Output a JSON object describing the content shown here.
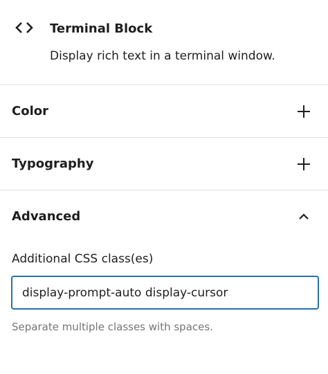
{
  "block": {
    "icon": "code-brackets-icon",
    "title": "Terminal Block",
    "description": "Display rich text in a terminal window."
  },
  "panels": [
    {
      "title": "Color",
      "expanded": false,
      "icon": "plus-icon"
    },
    {
      "title": "Typography",
      "expanded": false,
      "icon": "plus-icon"
    },
    {
      "title": "Advanced",
      "expanded": true,
      "icon": "chevron-up-icon"
    }
  ],
  "advanced": {
    "css_class_label": "Additional CSS class(es)",
    "css_class_value": "display-prompt-auto display-cursor",
    "css_class_help": "Separate multiple classes with spaces."
  },
  "colors": {
    "text": "#1e1e1e",
    "divider": "#e0e0e0",
    "focus": "#2271b1",
    "help_text": "#757575"
  }
}
